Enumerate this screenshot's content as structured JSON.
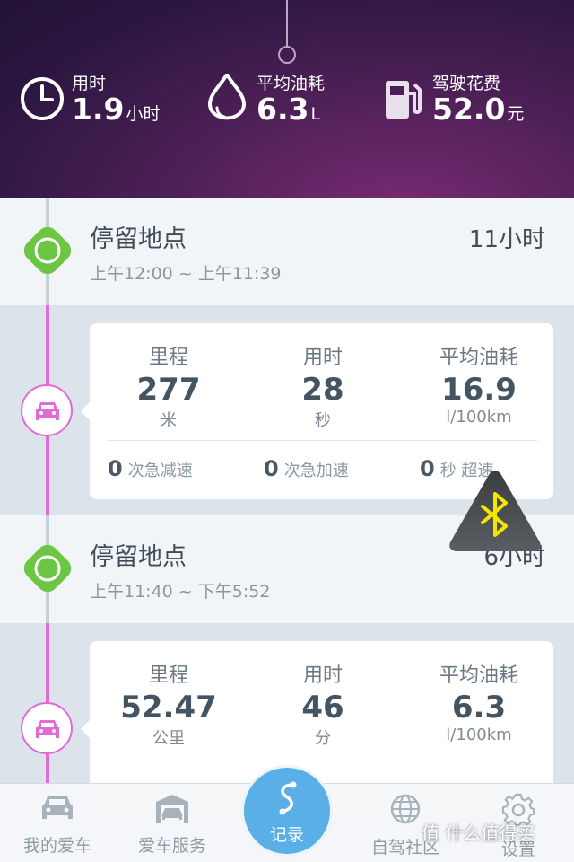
{
  "summary": {
    "time": {
      "label": "用时",
      "value": "1.9",
      "unit": "小时"
    },
    "fuel": {
      "label": "平均油耗",
      "value": "6.3",
      "unit": "L"
    },
    "cost": {
      "label": "驾驶花费",
      "value": "52.0",
      "unit": "元"
    }
  },
  "stops": [
    {
      "title": "停留地点",
      "time": "上午12:00 ~ 上午11:39",
      "duration": "11小时"
    },
    {
      "title": "停留地点",
      "time": "上午11:40 ~ 下午5:52",
      "duration": "6小时"
    }
  ],
  "trips": [
    {
      "distance": {
        "label": "里程",
        "value": "277",
        "unit": "米"
      },
      "duration": {
        "label": "用时",
        "value": "28",
        "unit": "秒"
      },
      "fuel": {
        "label": "平均油耗",
        "value": "16.9",
        "unit": "l/100km"
      },
      "events": [
        {
          "count": "0",
          "label": "次急减速"
        },
        {
          "count": "0",
          "label": "次急加速"
        },
        {
          "count": "0",
          "label": "秒 超速"
        }
      ]
    },
    {
      "distance": {
        "label": "里程",
        "value": "52.47",
        "unit": "公里"
      },
      "duration": {
        "label": "用时",
        "value": "46",
        "unit": "分"
      },
      "fuel": {
        "label": "平均油耗",
        "value": "6.3",
        "unit": "l/100km"
      }
    }
  ],
  "nav": {
    "my_car": "我的爱车",
    "car_service": "爱车服务",
    "record": "记录",
    "community": "自驾社区",
    "settings": "设置"
  },
  "watermark": "值 什么值得买",
  "colors": {
    "accent": "#5ab0e6",
    "trip_line": "#e06ad6",
    "stop_marker": "#6cc644",
    "header": "#4a1f55"
  },
  "icons": [
    "clock-icon",
    "drop-icon",
    "fuel-pump-icon",
    "car-icon",
    "garage-icon",
    "route-icon",
    "globe-icon",
    "gear-icon",
    "bluetooth-icon"
  ]
}
